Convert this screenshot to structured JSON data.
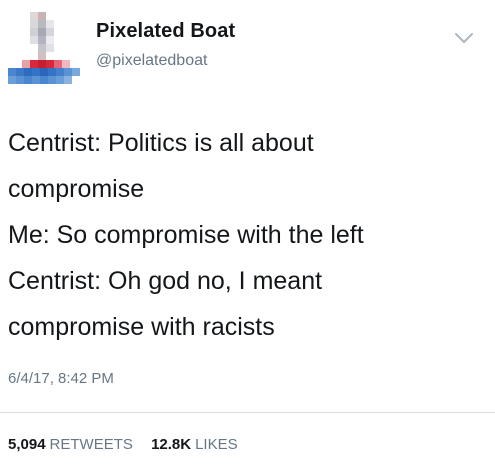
{
  "user": {
    "display_name": "Pixelated Boat",
    "handle": "@pixelatedboat",
    "avatar_icon": "pixelated-boat-avatar"
  },
  "tweet": {
    "lines": [
      "Centrist: Politics is all about",
      "compromise",
      "Me: So compromise with the left",
      "Centrist: Oh god no, I meant",
      "compromise with racists"
    ],
    "timestamp": "6/4/17, 8:42 PM"
  },
  "stats": {
    "retweets_count": "5,094",
    "retweets_label": "RETWEETS",
    "likes_count": "12.8K",
    "likes_label": "LIKES"
  },
  "icons": {
    "menu": "chevron-down-icon"
  },
  "colors": {
    "text_primary": "#14171a",
    "text_secondary": "#657786",
    "divider": "#d9dee2"
  }
}
